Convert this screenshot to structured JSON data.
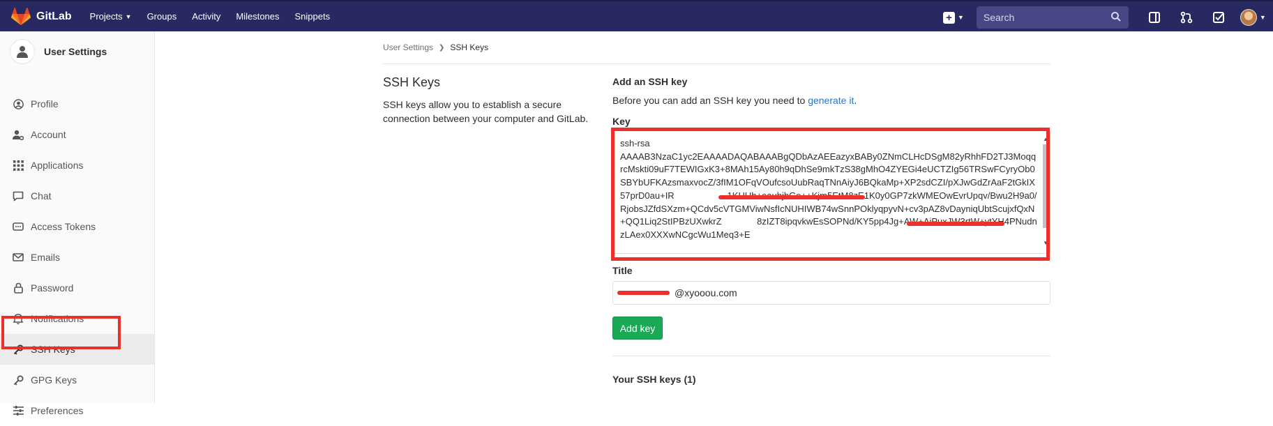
{
  "app": {
    "name": "GitLab"
  },
  "topnav": {
    "links": [
      "Projects",
      "Groups",
      "Activity",
      "Milestones",
      "Snippets"
    ],
    "search_placeholder": "Search"
  },
  "sidebar": {
    "title": "User Settings",
    "items": [
      {
        "label": "Profile",
        "icon": "user-icon"
      },
      {
        "label": "Account",
        "icon": "account-gear-icon"
      },
      {
        "label": "Applications",
        "icon": "grid-icon"
      },
      {
        "label": "Chat",
        "icon": "chat-icon"
      },
      {
        "label": "Access Tokens",
        "icon": "token-icon"
      },
      {
        "label": "Emails",
        "icon": "envelope-icon"
      },
      {
        "label": "Password",
        "icon": "lock-icon"
      },
      {
        "label": "Notifications",
        "icon": "bell-icon"
      },
      {
        "label": "SSH Keys",
        "icon": "key-icon",
        "active": true
      },
      {
        "label": "GPG Keys",
        "icon": "key-icon"
      },
      {
        "label": "Preferences",
        "icon": "sliders-icon"
      }
    ]
  },
  "breadcrumb": {
    "parent": "User Settings",
    "current": "SSH Keys"
  },
  "page": {
    "title": "SSH Keys",
    "description": "SSH keys allow you to establish a secure connection between your computer and GitLab."
  },
  "form": {
    "heading": "Add an SSH key",
    "intro_prefix": "Before you can add an SSH key you need to ",
    "intro_link": "generate it",
    "intro_suffix": ".",
    "key_label": "Key",
    "key_value": "ssh-rsa\nAAAAB3NzaC1yc2EAAAADAQABAAABgQDbAzAEEazyxBABy0ZNmCLHcDSgM82yRhhFD2TJ3MoqqrcMskti09uF7TEWIGxK3+8MAh15Ay80h9qDhSe9mkTzS38gMhO4ZYEGi4eUCTZIg56TRSwFCyryOb0SBYbUFKAzsmaxvocZ/3fIM1OFqVOufcsoUubRaqTNnAiyJ6BQkaMp+XP2sdCZI/pXJwGdZrAaF2tGkIX57prD0au+IR                     1KHUh+eauhjbGe++Kjm5EtM8zE1K0y0GP7zkWMEOwEvrUpqv/Bwu2H9a0/RjobsJZfdSXzm+QCdv5cVTGMViwNsfIcNUHIWB74wSnnPOklyqpyvN+cv3pAZ8vDayniqUbtScujxfQxN+QQ1Liq2StIPBzUXwkrZ              8zIZT8ipqvkwEsSOPNd/KY5pp4Jg+AW+AiPuxJW3rtW+ytYH4PNudnzLAex0XXXwNCgcWu1Meq3+E",
    "title_label": "Title",
    "title_value": "@xyooou.com",
    "submit_label": "Add key",
    "your_keys": "Your SSH keys (1)"
  }
}
